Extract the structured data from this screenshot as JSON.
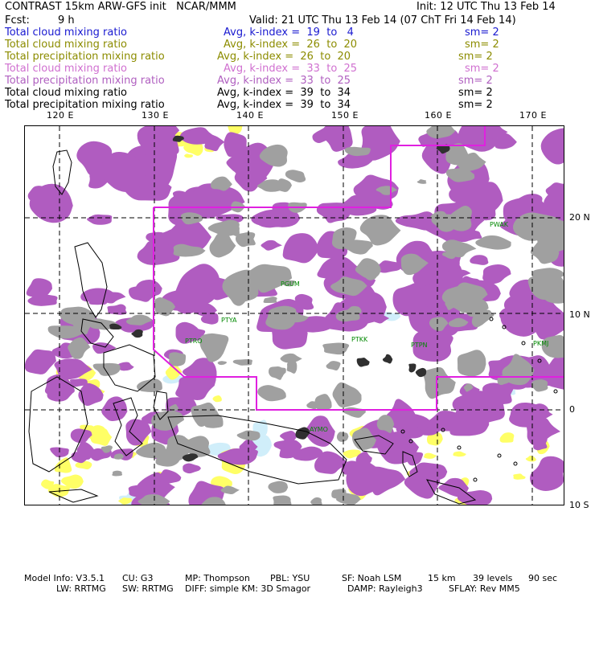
{
  "header": {
    "title": "CONTRAST 15km ARW-GFS init   NCAR/MMM",
    "init": "Init: 12 UTC Thu 13 Feb 14",
    "fcst_label": "Fcst:",
    "fcst_value": "9 h",
    "valid": "Valid: 21 UTC Thu 13 Feb 14 (07 ChT Fri 14 Feb 14)"
  },
  "legend": [
    {
      "field": "Total cloud mixing ratio",
      "avg": "Avg, k-index =  19  to   4",
      "sm": "sm= 2",
      "color": "#1a1ad0"
    },
    {
      "field": "Total cloud mixing ratio",
      "avg": "Avg, k-index =  26  to  20",
      "sm": "sm= 2",
      "color": "#8c8c00"
    },
    {
      "field": "Total precipitation mixing ratio",
      "avg": "Avg, k-index =  26  to  20",
      "sm": "sm= 2",
      "color": "#8c8c00"
    },
    {
      "field": "Total cloud mixing ratio",
      "avg": "Avg, k-index =  33  to  25",
      "sm": "sm= 2",
      "color": "#d070d0"
    },
    {
      "field": "Total precipitation mixing ratio",
      "avg": "Avg, k-index =  33  to  25",
      "sm": "sm= 2",
      "color": "#b060c0"
    },
    {
      "field": "Total cloud mixing ratio",
      "avg": "Avg, k-index =  39  to  34",
      "sm": "sm= 2",
      "color": "#000000"
    },
    {
      "field": "Total precipitation mixing ratio",
      "avg": "Avg, k-index =  39  to  34",
      "sm": "sm= 2",
      "color": "#000000"
    }
  ],
  "map": {
    "lon_labels": [
      "120 E",
      "130 E",
      "140 E",
      "150 E",
      "160 E",
      "170 E"
    ],
    "lat_labels": [
      "20 N",
      "10 N",
      "0",
      "10 S"
    ],
    "stations": [
      "PGUM",
      "PTYA",
      "PTRO",
      "PTKK",
      "PTPN",
      "PKMJ",
      "PWAK",
      "AYMO"
    ],
    "colors": {
      "high_cloud": "#b05cc0",
      "mid_cloud": "#a0a0a0",
      "low_cloud": "#ffff66",
      "deep_core": "#303030",
      "shallow": "#d0eefa",
      "domain_box": "#e020e0",
      "station": "#008800"
    }
  },
  "footer": {
    "line1": [
      "Model Info: V3.5.1",
      "CU: G3",
      "MP: Thompson",
      "PBL: YSU",
      "SF: Noah LSM",
      "15 km",
      "39 levels",
      "90 sec"
    ],
    "line2": [
      "LW: RRTMG",
      "SW: RRTMG",
      "DIFF: simple KM: 3D Smagor",
      "DAMP: Rayleigh3",
      "SFLAY: Rev MM5"
    ]
  }
}
